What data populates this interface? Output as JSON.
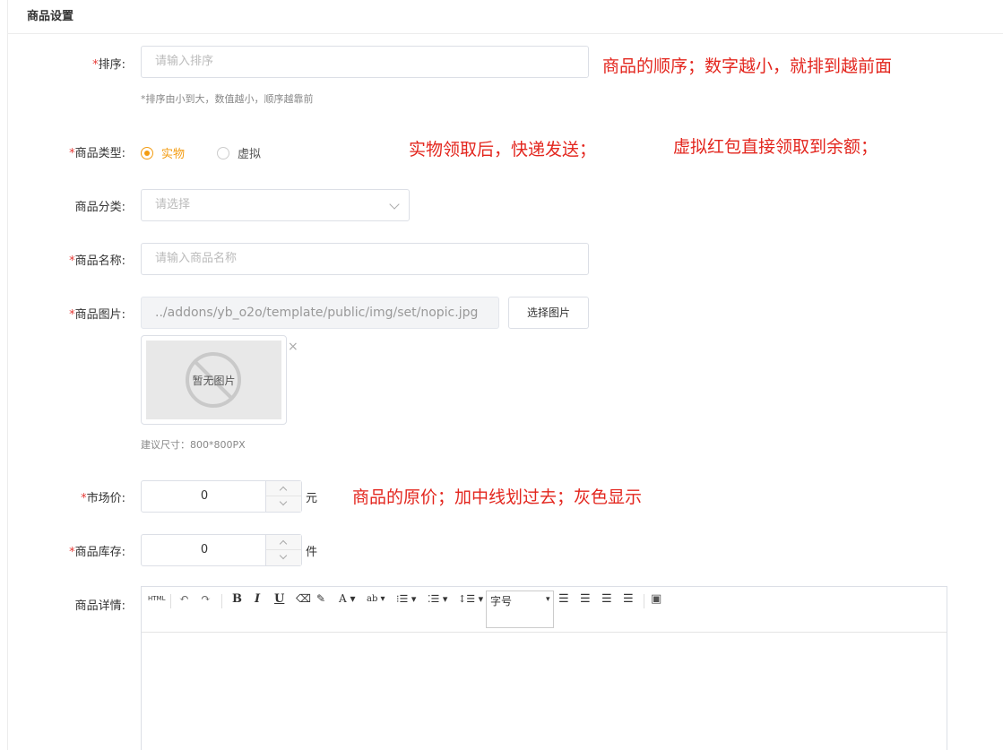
{
  "panel": {
    "title": "商品设置"
  },
  "form": {
    "sort": {
      "required_mark": "*",
      "label": "排序:",
      "placeholder": "请输入排序",
      "help": "*排序由小到大，数值越小，顺序越靠前",
      "annotation": "商品的顺序；数字越小，就排到越前面"
    },
    "type": {
      "required_mark": "*",
      "label": "商品类型:",
      "options": [
        {
          "label": "实物",
          "selected": true
        },
        {
          "label": "虚拟",
          "selected": false
        }
      ],
      "annotation_1": "实物领取后，快递发送；",
      "annotation_2": "虚拟红包直接领取到余额；"
    },
    "category": {
      "label": "商品分类:",
      "placeholder": "请选择"
    },
    "name": {
      "required_mark": "*",
      "label": "商品名称:",
      "placeholder": "请输入商品名称"
    },
    "image": {
      "required_mark": "*",
      "label": "商品图片:",
      "path": "../addons/yb_o2o/template/public/img/set/nopic.jpg",
      "choose_button": "选择图片",
      "placeholder_text": "暂无图片",
      "close_symbol": "×",
      "help": "建议尺寸：800*800PX"
    },
    "market_price": {
      "required_mark": "*",
      "label": "市场价:",
      "value": "0",
      "unit": "元",
      "annotation": "商品的原价；加中线划过去；灰色显示"
    },
    "stock": {
      "required_mark": "*",
      "label": "商品库存:",
      "value": "0",
      "unit": "件"
    },
    "detail": {
      "label": "商品详情:",
      "toolbar": {
        "html": "HTML",
        "undo": "↶",
        "redo": "↷",
        "bold": "B",
        "italic": "I",
        "underline": "U",
        "eraser": "⌫",
        "brush": "✎",
        "font_color": "A ▾",
        "highlight": "ab ▾",
        "ordered_list": "⁝☰ ▾",
        "unordered_list": "⁚☰ ▾",
        "line_height": "↕☰ ▾",
        "font_size": "字号",
        "font_size_arrow": "▾",
        "align_left": "☰",
        "align_right": "☰",
        "align_center": "☰",
        "align_justify": "☰",
        "image": "▣"
      }
    }
  },
  "colors": {
    "accent": "#f39c12",
    "annotation": "#e3261e",
    "required": "#e53935"
  }
}
